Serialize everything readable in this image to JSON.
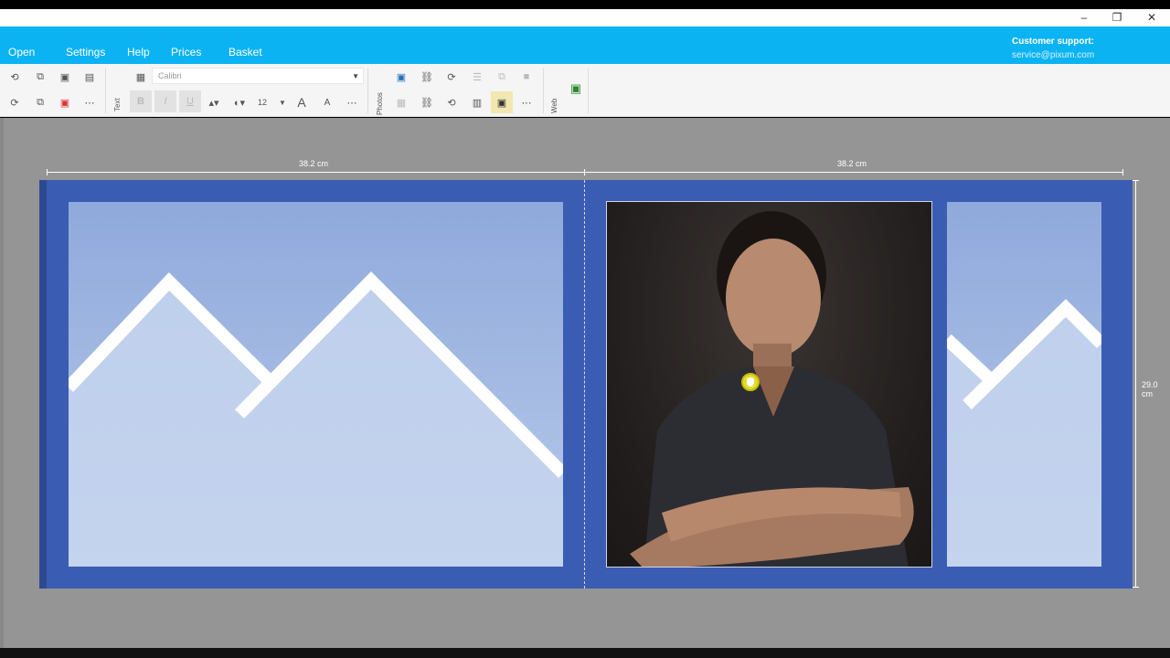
{
  "window": {
    "minimize_icon": "minimize-icon",
    "maximize_icon": "restore-icon",
    "close_icon": "close-icon",
    "minimize_glyph": "–",
    "restore_glyph": "❐",
    "close_glyph": "✕"
  },
  "menu": {
    "items": [
      {
        "label": "Open"
      },
      {
        "label": "Settings"
      },
      {
        "label": "Help"
      },
      {
        "label": "Prices"
      },
      {
        "label": "Basket"
      }
    ]
  },
  "support": {
    "title": "Customer support:",
    "email": "service@pixum.com"
  },
  "toolbar": {
    "text_label": "Text",
    "photos_label": "Photos",
    "web_label": "Web",
    "font_name": "Calibri",
    "font_size": "12",
    "bold": "B",
    "italic": "I",
    "underline": "U",
    "grow_font": "A",
    "shrink_font": "A",
    "more": "⋯"
  },
  "canvas": {
    "ruler_left": "38.2 cm",
    "ruler_right": "38.2 cm",
    "ruler_height": "29.0 cm"
  },
  "colors": {
    "accent": "#0cb3f2",
    "spread_bg": "#3a5db3",
    "workspace": "#959595"
  }
}
